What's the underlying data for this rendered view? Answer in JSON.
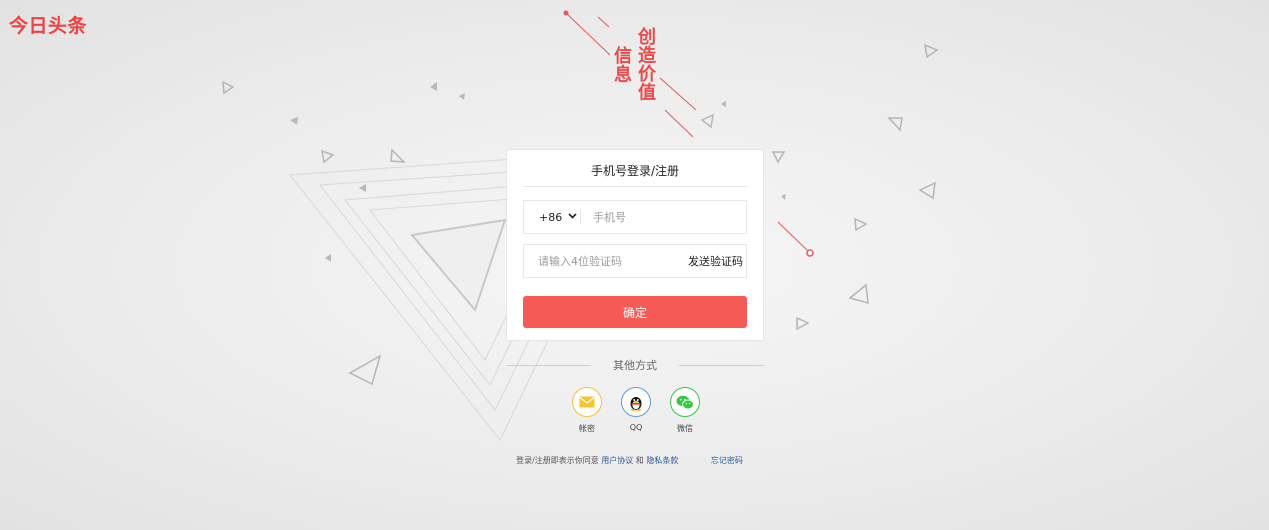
{
  "brand": {
    "logo": "今日头条",
    "accent": "#f04142"
  },
  "slogan": {
    "line1": "创造价值",
    "line2": "信息"
  },
  "login": {
    "title": "手机号登录/注册",
    "country_code": "+86",
    "phone_placeholder": "手机号",
    "code_placeholder": "请输入4位验证码",
    "send_code": "发送验证码",
    "submit": "确定",
    "button_color": "#f65a57"
  },
  "other_methods": {
    "label": "其他方式",
    "items": [
      {
        "icon": "mail-icon",
        "label": "帐密"
      },
      {
        "icon": "qq-penguin-icon",
        "label": "QQ"
      },
      {
        "icon": "wechat-icon",
        "label": "微信"
      }
    ]
  },
  "agreement": {
    "prefix": "登录/注册即表示你同意",
    "user_agreement": "用户协议",
    "and": "和",
    "privacy": "隐私条款",
    "forgot": "忘记密码"
  }
}
